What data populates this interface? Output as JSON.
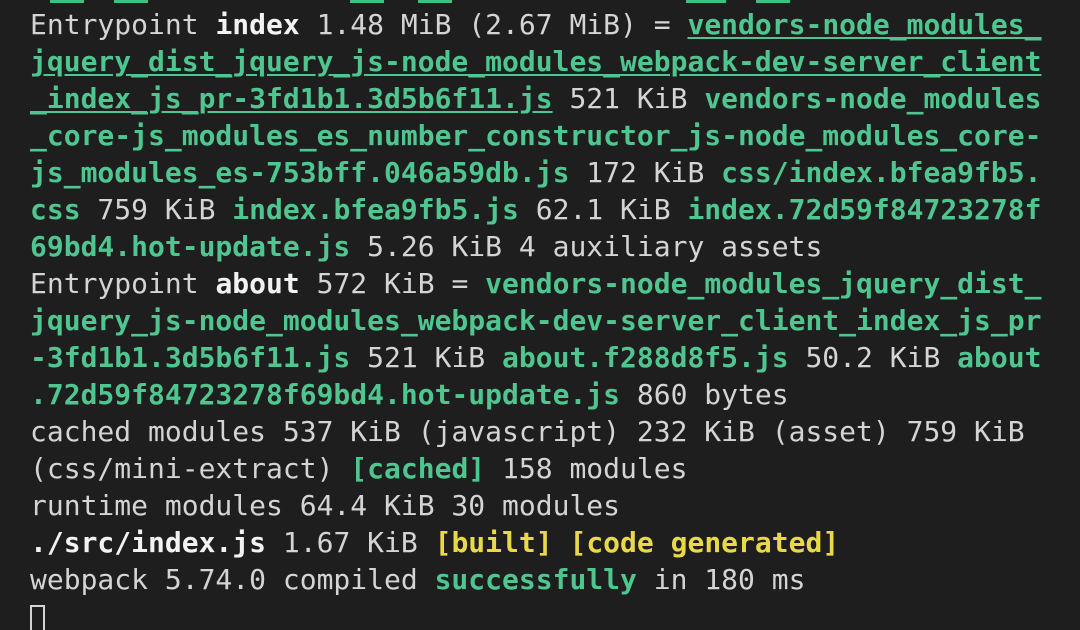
{
  "terminal": {
    "lines": [
      {
        "t1": "Entrypoint ",
        "t2": "index",
        "t3": " 1.48 MiB (2.67 MiB) = ",
        "t4": "vendors-node_modules_"
      },
      {
        "t1": "jquery_dist_jquery_js-node_modules_webpack-dev-server_client"
      },
      {
        "t1": "_index_js_pr-3fd1b1.3d5b6f11.js",
        "t2": " 521 KiB ",
        "t3": "vendors-node_modules"
      },
      {
        "t1": "_core-js_modules_es_number_constructor_js-node_modules_core-"
      },
      {
        "t1": "js_modules_es-753bff.046a59db.js",
        "t2": " 172 KiB ",
        "t3": "css/index.bfea9fb5."
      },
      {
        "t1": "css",
        "t2": " 759 KiB ",
        "t3": "index.bfea9fb5.js",
        "t4": " 62.1 KiB ",
        "t5": "index.72d59f84723278f"
      },
      {
        "t1": "69bd4.hot-update.js",
        "t2": " 5.26 KiB 4 auxiliary assets"
      },
      {
        "t1": "Entrypoint ",
        "t2": "about",
        "t3": " 572 KiB = ",
        "t4": "vendors-node_modules_jquery_dist_"
      },
      {
        "t1": "jquery_js-node_modules_webpack-dev-server_client_index_js_pr"
      },
      {
        "t1": "-3fd1b1.3d5b6f11.js",
        "t2": " 521 KiB ",
        "t3": "about.f288d8f5.js",
        "t4": " 50.2 KiB ",
        "t5": "about"
      },
      {
        "t1": ".72d59f84723278f69bd4.hot-update.js",
        "t2": " 860 bytes"
      },
      {
        "t1": "cached modules 537 KiB (javascript) 232 KiB (asset) 759 KiB"
      },
      {
        "t1": "(css/mini-extract) ",
        "t2": "[cached]",
        "t3": " 158 modules"
      },
      {
        "t1": "runtime modules 64.4 KiB 30 modules"
      },
      {
        "t1": "./src/index.js",
        "t2": " 1.67 KiB ",
        "t3": "[built]",
        "t4": " ",
        "t5": "[code generated]"
      },
      {
        "t1": "webpack 5.74.0 compiled ",
        "t2": "successfully",
        "t3": " in 180 ms"
      }
    ]
  },
  "colors": {
    "background": "#1e1e1e",
    "text": "#d4d4d4",
    "asset_green": "#4fc58f",
    "status_yellow": "#e8d84a"
  }
}
